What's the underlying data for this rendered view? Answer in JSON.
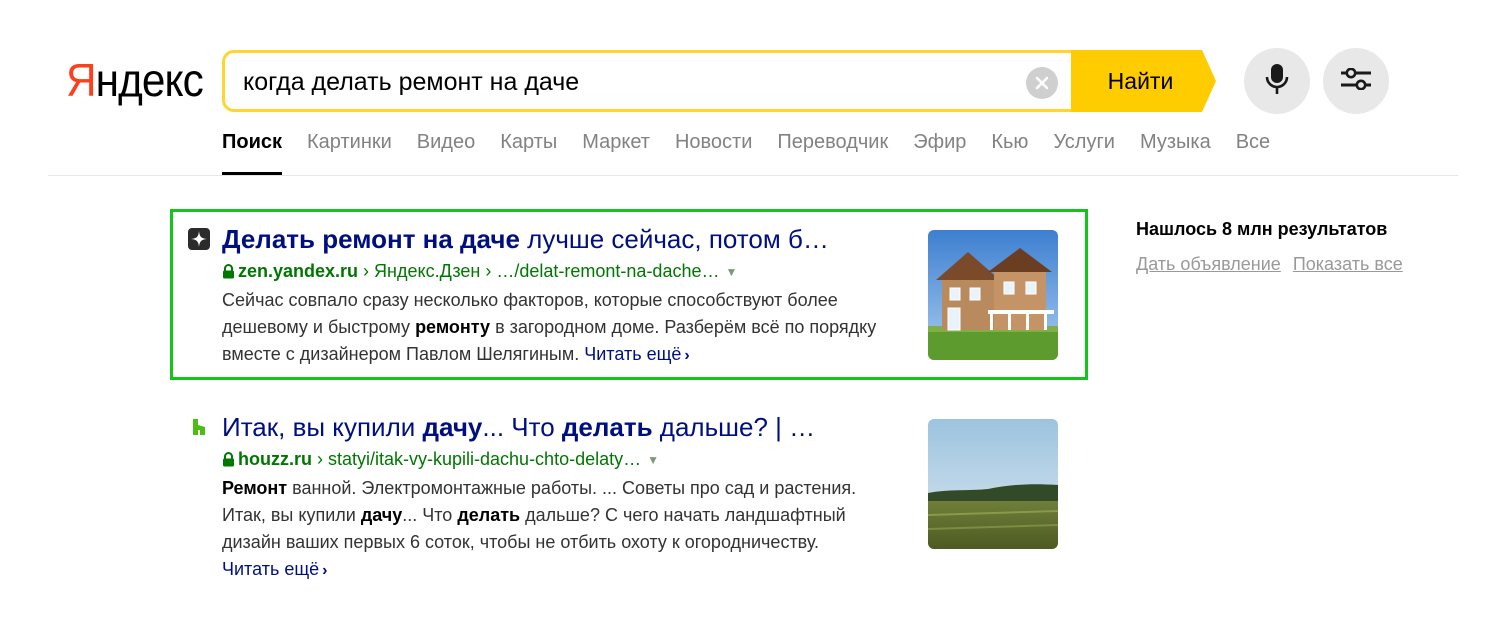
{
  "logo": {
    "first": "Я",
    "rest": "ндекс"
  },
  "search": {
    "query": "когда делать ремонт на даче",
    "button": "Найти"
  },
  "nav": {
    "items": [
      "Поиск",
      "Картинки",
      "Видео",
      "Карты",
      "Маркет",
      "Новости",
      "Переводчик",
      "Эфир",
      "Кью",
      "Услуги",
      "Музыка",
      "Все"
    ],
    "active_index": 0
  },
  "results": [
    {
      "title_bold": "Делать ремонт на даче",
      "title_rest": " лучше сейчас, потом б…",
      "domain": "zen.yandex.ru",
      "sep1": " › ",
      "crumb": "Яндекс.Дзен",
      "sep2": " › ",
      "path": "…/delat-remont-na-dache…",
      "snippet": {
        "p1": "Сейчас совпало сразу несколько факторов, которые способствуют более дешевому и быстрому ",
        "b1": "ремонту",
        "p2": " в загородном доме. Разберём всё по порядку вместе с дизайнером Павлом Шелягиным. "
      },
      "read_more": "Читать ещё"
    },
    {
      "title_p1": "Итак, вы купили ",
      "title_b1": "дачу",
      "title_p2": "... Что ",
      "title_b2": "делать",
      "title_p3": " дальше? | …",
      "domain": "houzz.ru",
      "sep1": " › ",
      "path": "statyi/itak-vy-kupili-dachu-chto-delaty…",
      "snippet": {
        "b1": "Ремонт",
        "p1": " ванной. Электромонтажные работы. ... Советы про сад и растения. Итак, вы купили ",
        "b2": "дачу",
        "p2": "... Что ",
        "b3": "делать",
        "p3": " дальше? С чего начать ландшафтный дизайн ваших первых 6 соток, чтобы не отбить охоту к огородничеству. "
      },
      "read_more": "Читать ещё"
    }
  ],
  "sidebar": {
    "found": "Нашлось 8 млн результатов",
    "link_ad": "Дать объявление",
    "link_all": "Показать все"
  },
  "colors": {
    "search_yellow": "#ffcc00",
    "title_blue": "#000f80",
    "url_green": "#007700",
    "highlight_green": "#13c518",
    "logo_red": "#fc3f1d"
  },
  "icons": {
    "clear": "close-icon",
    "mic": "microphone-icon",
    "filters": "sliders-icon",
    "lock": "lock-icon",
    "zen": "zen-icon",
    "houzz": "houzz-icon"
  }
}
